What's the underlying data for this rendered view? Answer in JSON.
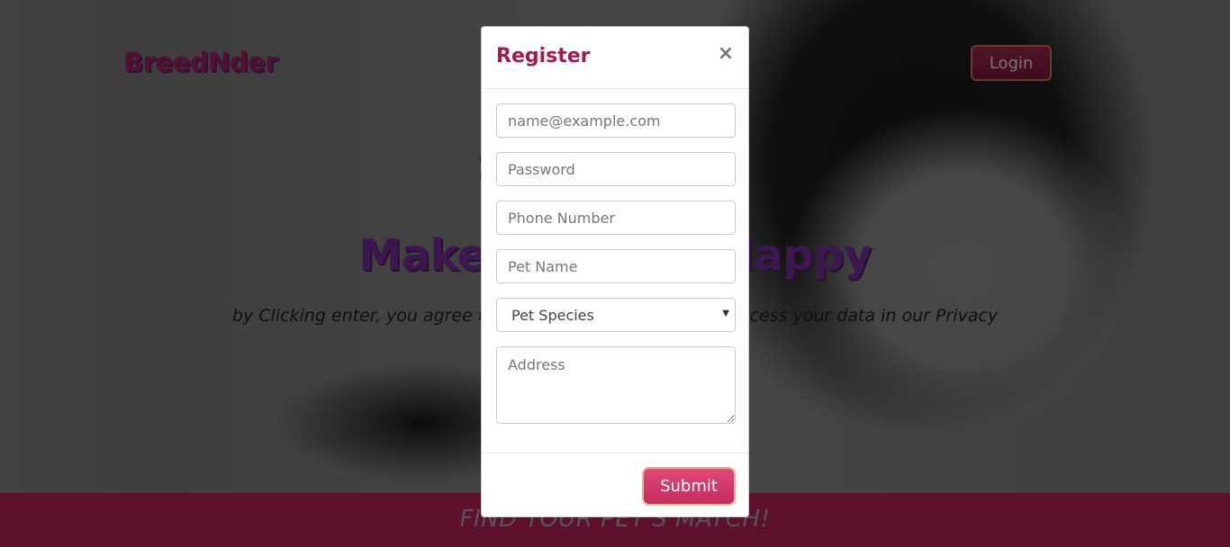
{
  "header": {
    "brand": "BreedNder",
    "login_label": "Login"
  },
  "hero": {
    "partial_heading": "S",
    "title": "Make your Pet Happy",
    "text": "by Clicking enter, you agree to our Terms. Learn how we process your data in our Privacy"
  },
  "footer": {
    "tagline": "FIND YOUR PET'S MATCH!"
  },
  "modal": {
    "title": "Register",
    "close_symbol": "×",
    "fields": {
      "email_placeholder": "name@example.com",
      "password_placeholder": "Password",
      "phone_placeholder": "Phone Number",
      "pet_name_placeholder": "Pet Name",
      "pet_species_selected": "Pet Species",
      "address_placeholder": "Address"
    },
    "submit_label": "Submit"
  },
  "colors": {
    "accent": "#a8184f",
    "footer_bar": "#a31e4c",
    "submit_gradient_top": "#e0487a",
    "submit_gradient_bottom": "#c42c5f"
  },
  "icons": {
    "close": "close-icon",
    "select_arrow": "chevron-down-icon"
  }
}
